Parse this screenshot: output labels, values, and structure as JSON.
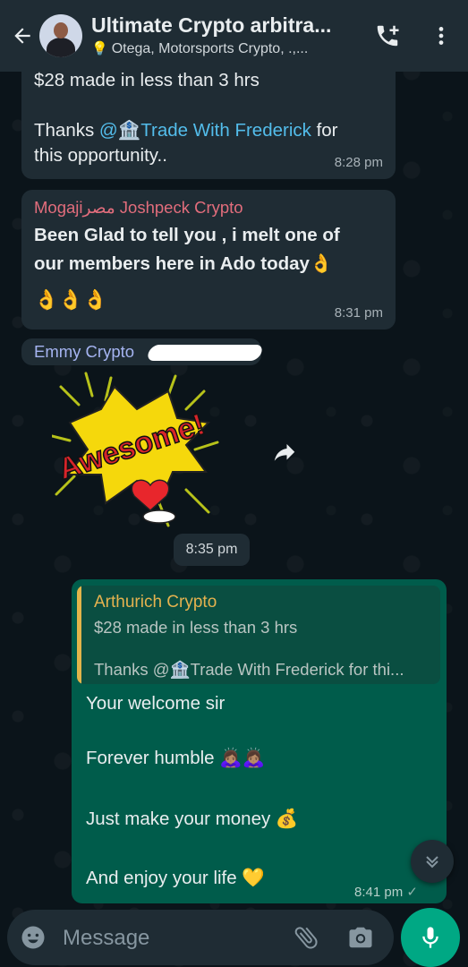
{
  "header": {
    "title": "Ultimate Crypto arbitra...",
    "subtitle": "Otega,  Motorsports Crypto, .,..."
  },
  "messages": {
    "m1": {
      "line1": "$28 made in less than 3 hrs",
      "thanks_prefix": "Thanks ",
      "mention": "@🏦Trade With Frederick",
      "thanks_suffix": " for",
      "line3": "this opportunity..",
      "time": "8:28 pm"
    },
    "m2": {
      "sender": "Mogajiمصر Joshpeck Crypto",
      "line1": "Been Glad to tell you , i melt one of",
      "line2": "our members here in Ado today👌",
      "line3": "👌👌👌",
      "time": "8:31 pm"
    },
    "m3": {
      "sender": "Emmy Crypto",
      "sticker_text": "Awesome!"
    },
    "date_chip": "8:35 pm",
    "m4": {
      "quote_name": "Arthurich Crypto",
      "quote_line1": "$28 made in less than 3 hrs",
      "quote_line2": "Thanks @🏦Trade With Frederick for thi...",
      "line1": "Your welcome sir",
      "line2": "Forever humble 🙇🏽‍♀️🙇🏽‍♀️",
      "line3": "Just make your money 💰",
      "line4": "And enjoy your life 💛",
      "time": "8:41 pm",
      "tick": "✓"
    }
  },
  "composer": {
    "placeholder": "Message"
  },
  "colors": {
    "header_bg": "#1f2c34",
    "incoming_bubble": "#1f2c34",
    "outgoing_bubble": "#005c4b",
    "accent_green": "#00a884",
    "mention_blue": "#53bdeb",
    "sender_pink": "#e26d7c",
    "sender_lavender": "#a5b4f1",
    "quote_gold": "#e5b24f"
  },
  "icons": [
    "back-arrow-icon",
    "add-call-icon",
    "more-vert-icon",
    "forward-icon",
    "scroll-down-icon",
    "emoji-icon",
    "attach-icon",
    "camera-icon",
    "mic-icon"
  ]
}
